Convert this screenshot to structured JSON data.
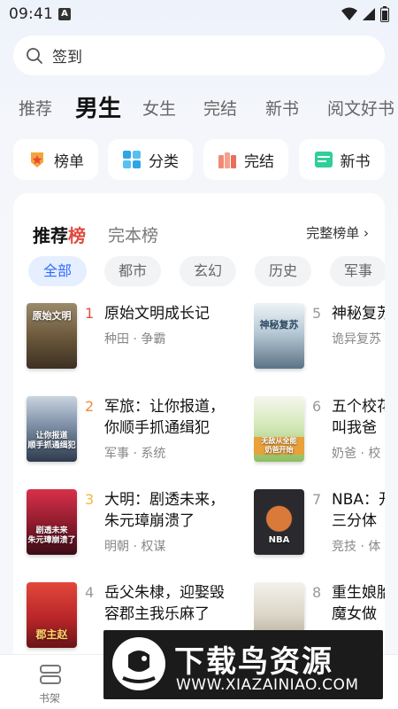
{
  "status": {
    "time": "09:41",
    "notif_letter": "A"
  },
  "search": {
    "text": "签到"
  },
  "tabs": [
    "推荐",
    "男生",
    "女生",
    "完结",
    "新书",
    "阅文好书"
  ],
  "quick": [
    {
      "label": "榜单",
      "icon": "medal-icon"
    },
    {
      "label": "分类",
      "icon": "grid-icon"
    },
    {
      "label": "完结",
      "icon": "books-icon"
    },
    {
      "label": "新书",
      "icon": "new-badge-icon"
    }
  ],
  "panel": {
    "title_a": "推荐",
    "title_b": "榜",
    "subtitle": "完本榜",
    "more": "完整榜单 ›"
  },
  "chips": [
    "全部",
    "都市",
    "玄幻",
    "历史",
    "军事"
  ],
  "books": [
    {
      "rank": "1",
      "title": "原始文明成长记",
      "meta": "种田 · 争霸",
      "cover_text": "原始文明"
    },
    {
      "rank": "2",
      "title": "军旅：让你报道，\n你顺手抓通缉犯",
      "meta": "军事 · 系统",
      "cover_text": "让你报道\n顺手抓通缉犯"
    },
    {
      "rank": "3",
      "title": "大明：剧透未来，\n朱元璋崩溃了",
      "meta": "明朝 · 权谋",
      "cover_text": "剧透未来\n朱元璋崩溃了"
    },
    {
      "rank": "4",
      "title": "岳父朱棣，迎娶毁\n容郡主我乐麻了",
      "meta": "",
      "cover_text": "郡主赵"
    },
    {
      "rank": "5",
      "title": "神秘复苏",
      "meta": "诡异复苏",
      "cover_text": "神秘复苏"
    },
    {
      "rank": "6",
      "title": "五个校花\n叫我爸",
      "meta": "奶爸 · 校",
      "cover_text": "无敌从全能\n奶爸开始"
    },
    {
      "rank": "7",
      "title": "NBA：开局\n三分体",
      "meta": "竞技 · 体",
      "cover_text": "NBA"
    },
    {
      "rank": "8",
      "title": "重生娘胎\n魔女做",
      "meta": "",
      "cover_text": ""
    }
  ],
  "bottom_nav": [
    {
      "label": "书架"
    }
  ],
  "watermark": {
    "title": "下载鸟资源",
    "url": "WWW.XIAZAINIAO.COM"
  }
}
